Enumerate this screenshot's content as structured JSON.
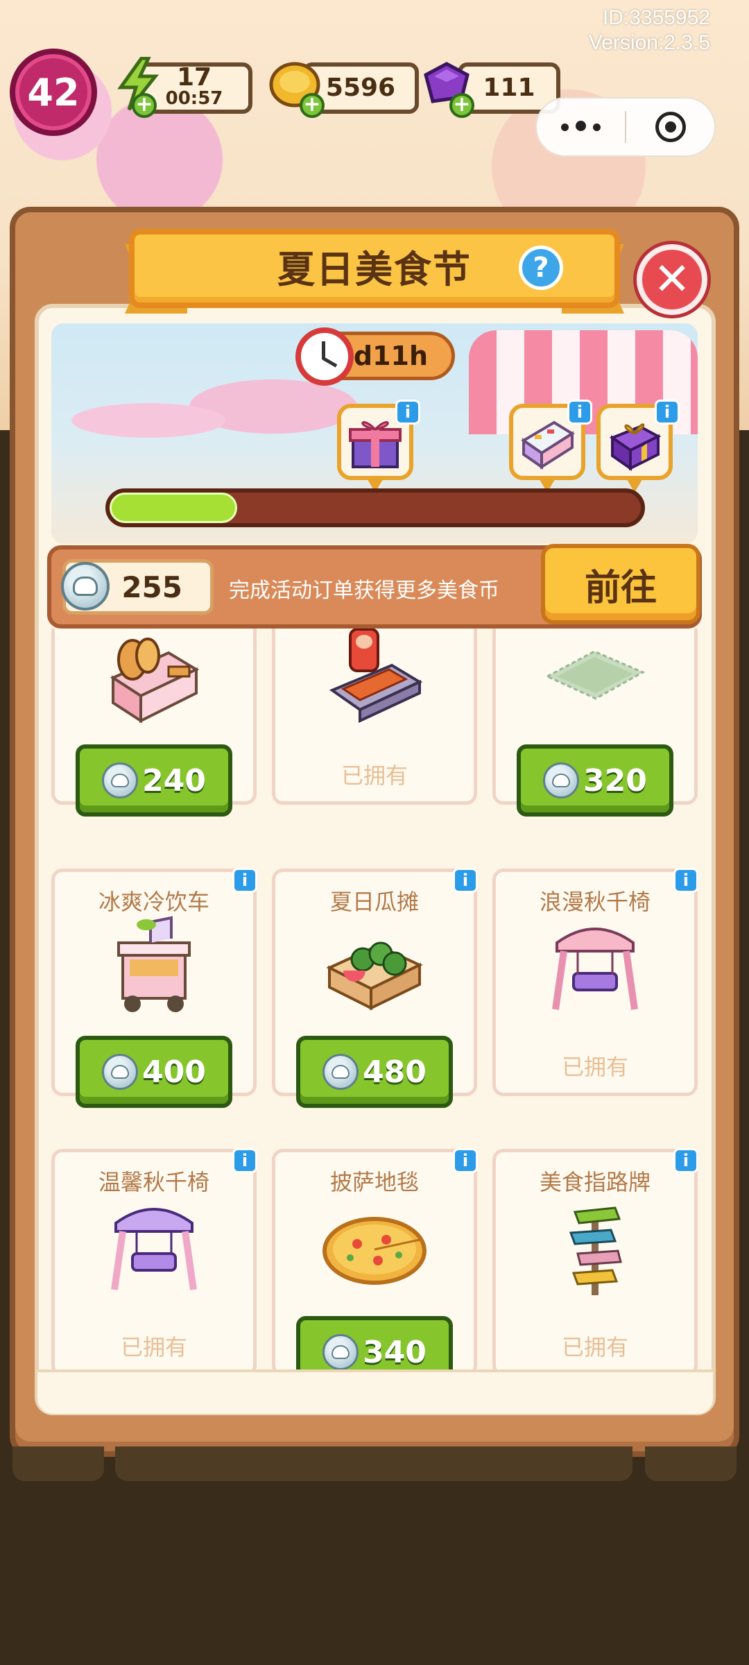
{
  "meta": {
    "id_label": "ID:3355952",
    "version_label": "Version:2.3.5"
  },
  "hud": {
    "level": "42",
    "energy": {
      "value": "17",
      "timer": "00:57"
    },
    "gold": {
      "value": "5596"
    },
    "gems": {
      "value": "111"
    }
  },
  "capsule": {
    "more_icon": "more-dots-icon",
    "close_icon": "target-circle-icon"
  },
  "panel": {
    "title": "夏日美食节",
    "help_label": "?",
    "close_label": "✕"
  },
  "event": {
    "timer": "11d11h",
    "progress": 0.24,
    "rewards": [
      {
        "icon": "gift-box-icon",
        "info": "i"
      },
      {
        "icon": "display-case-icon",
        "info": "i"
      },
      {
        "icon": "purple-gift-icon",
        "info": "i"
      }
    ]
  },
  "currency": {
    "amount": "255",
    "hint": "完成活动订单获得更多美食币",
    "goto_label": "前往"
  },
  "items": [
    {
      "name": "",
      "icon": "bread-stall-icon",
      "price": "240",
      "owned": false,
      "info": ""
    },
    {
      "name": "",
      "icon": "sausage-grill-icon",
      "price": "",
      "owned": true,
      "owned_label": "已拥有",
      "info": ""
    },
    {
      "name": "",
      "icon": "green-rug-icon",
      "price": "320",
      "owned": false,
      "info": ""
    },
    {
      "name": "冰爽冷饮车",
      "icon": "drink-cart-icon",
      "price": "400",
      "owned": false,
      "info": "i"
    },
    {
      "name": "夏日瓜摊",
      "icon": "melon-stand-icon",
      "price": "480",
      "owned": false,
      "info": "i"
    },
    {
      "name": "浪漫秋千椅",
      "icon": "pink-swing-icon",
      "price": "",
      "owned": true,
      "owned_label": "已拥有",
      "info": "i"
    },
    {
      "name": "温馨秋千椅",
      "icon": "purple-swing-icon",
      "price": "",
      "owned": true,
      "owned_label": "已拥有",
      "info": "i"
    },
    {
      "name": "披萨地毯",
      "icon": "pizza-rug-icon",
      "price": "340",
      "owned": false,
      "info": "i"
    },
    {
      "name": "美食指路牌",
      "icon": "food-signpost-icon",
      "price": "",
      "owned": true,
      "owned_label": "已拥有",
      "info": "i"
    }
  ]
}
